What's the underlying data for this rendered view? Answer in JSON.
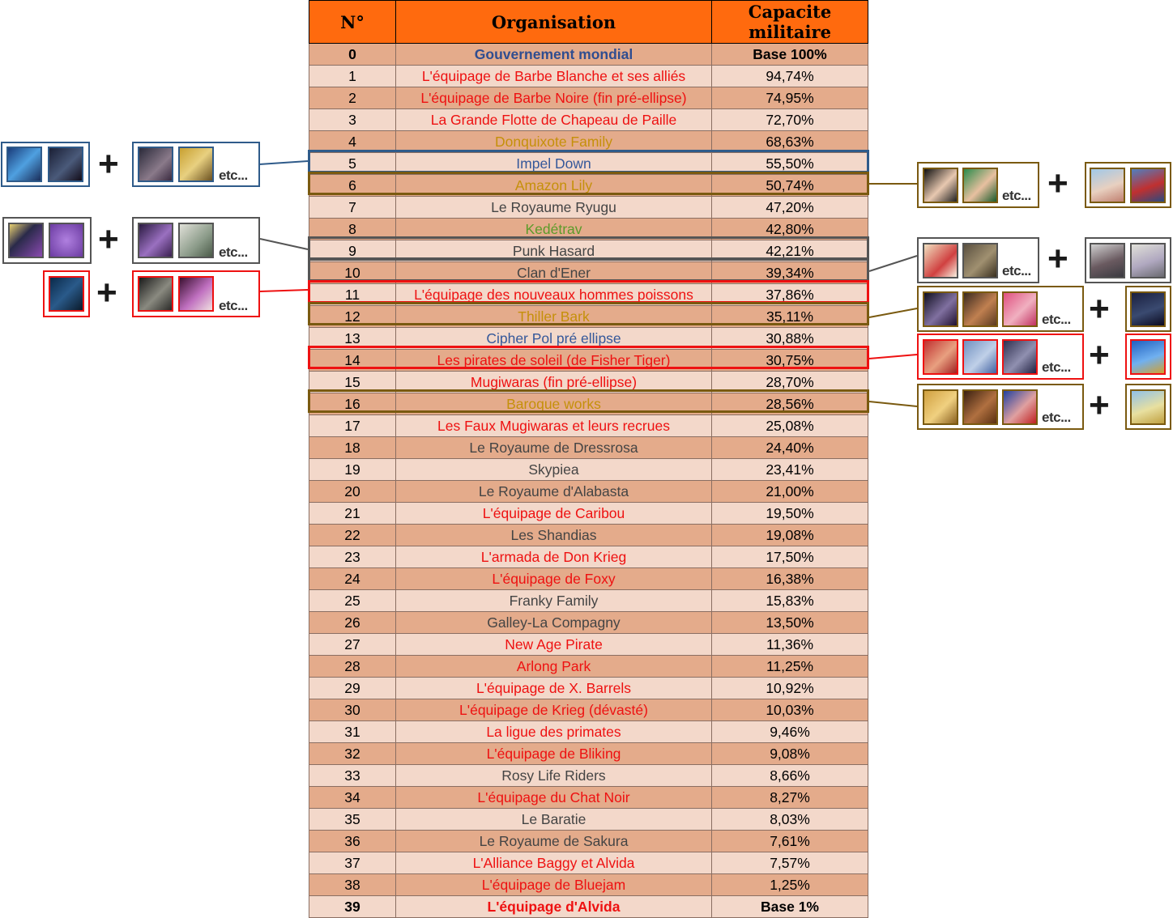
{
  "header": {
    "num": "N°",
    "org": "Organisation",
    "pct": "Capacite militaire"
  },
  "rows": [
    {
      "num": "0",
      "org": "Gouvernement mondial",
      "pct": "Base 100%",
      "color": "navy",
      "bold": true
    },
    {
      "num": "1",
      "org": "L'équipage de Barbe Blanche et ses alliés",
      "pct": "94,74%",
      "color": "red"
    },
    {
      "num": "2",
      "org": "L'équipage de Barbe Noire (fin pré-ellipse)",
      "pct": "74,95%",
      "color": "red"
    },
    {
      "num": "3",
      "org": "La Grande Flotte de Chapeau de Paille",
      "pct": "72,70%",
      "color": "red"
    },
    {
      "num": "4",
      "org": "Donquixote Family",
      "pct": "68,63%",
      "color": "gold"
    },
    {
      "num": "5",
      "org": "Impel Down",
      "pct": "55,50%",
      "color": "blue"
    },
    {
      "num": "6",
      "org": "Amazon Lily",
      "pct": "50,74%",
      "color": "gold"
    },
    {
      "num": "7",
      "org": "Le Royaume Ryugu",
      "pct": "47,20%",
      "color": "gray"
    },
    {
      "num": "8",
      "org": "Kedétrav",
      "pct": "42,80%",
      "color": "green"
    },
    {
      "num": "9",
      "org": "Punk Hasard",
      "pct": "42,21%",
      "color": "gray"
    },
    {
      "num": "10",
      "org": "Clan d'Ener",
      "pct": "39,34%",
      "color": "gray"
    },
    {
      "num": "11",
      "org": "L'équipage des nouveaux hommes poissons",
      "pct": "37,86%",
      "color": "red"
    },
    {
      "num": "12",
      "org": "Thiller Bark",
      "pct": "35,11%",
      "color": "gold"
    },
    {
      "num": "13",
      "org": "Cipher Pol pré ellipse",
      "pct": "30,88%",
      "color": "blue"
    },
    {
      "num": "14",
      "org": "Les pirates de soleil (de Fisher Tiger)",
      "pct": "30,75%",
      "color": "red"
    },
    {
      "num": "15",
      "org": "Mugiwaras (fin pré-ellipse)",
      "pct": "28,70%",
      "color": "red"
    },
    {
      "num": "16",
      "org": "Baroque works",
      "pct": "28,56%",
      "color": "gold"
    },
    {
      "num": "17",
      "org": "Les Faux Mugiwaras et leurs recrues",
      "pct": "25,08%",
      "color": "red"
    },
    {
      "num": "18",
      "org": "Le Royaume de Dressrosa",
      "pct": "24,40%",
      "color": "gray"
    },
    {
      "num": "19",
      "org": "Skypiea",
      "pct": "23,41%",
      "color": "gray"
    },
    {
      "num": "20",
      "org": "Le Royaume d'Alabasta",
      "pct": "21,00%",
      "color": "gray"
    },
    {
      "num": "21",
      "org": "L'équipage de Caribou",
      "pct": "19,50%",
      "color": "red"
    },
    {
      "num": "22",
      "org": "Les Shandias",
      "pct": "19,08%",
      "color": "gray"
    },
    {
      "num": "23",
      "org": "L'armada de Don Krieg",
      "pct": "17,50%",
      "color": "red"
    },
    {
      "num": "24",
      "org": "L'équipage de Foxy",
      "pct": "16,38%",
      "color": "red"
    },
    {
      "num": "25",
      "org": "Franky Family",
      "pct": "15,83%",
      "color": "gray"
    },
    {
      "num": "26",
      "org": "Galley-La Compagny",
      "pct": "13,50%",
      "color": "gray"
    },
    {
      "num": "27",
      "org": "New Age Pirate",
      "pct": "11,36%",
      "color": "red"
    },
    {
      "num": "28",
      "org": "Arlong Park",
      "pct": "11,25%",
      "color": "red"
    },
    {
      "num": "29",
      "org": "L'équipage de X. Barrels",
      "pct": "10,92%",
      "color": "red"
    },
    {
      "num": "30",
      "org": "L'équipage de Krieg (dévasté)",
      "pct": "10,03%",
      "color": "red"
    },
    {
      "num": "31",
      "org": "La ligue des primates",
      "pct": "9,46%",
      "color": "red"
    },
    {
      "num": "32",
      "org": "L'équipage de Bliking",
      "pct": "9,08%",
      "color": "red"
    },
    {
      "num": "33",
      "org": "Rosy Life Riders",
      "pct": "8,66%",
      "color": "gray"
    },
    {
      "num": "34",
      "org": "L'équipage du Chat Noir",
      "pct": "8,27%",
      "color": "red"
    },
    {
      "num": "35",
      "org": "Le Baratie",
      "pct": "8,03%",
      "color": "gray"
    },
    {
      "num": "36",
      "org": "Le Royaume de Sakura",
      "pct": "7,61%",
      "color": "gray"
    },
    {
      "num": "37",
      "org": "L'Alliance Baggy et Alvida",
      "pct": "7,57%",
      "color": "red"
    },
    {
      "num": "38",
      "org": "L'équipage de Bluejam",
      "pct": "1,25%",
      "color": "red"
    },
    {
      "num": "39",
      "org": "L'équipage d'Alvida",
      "pct": "Base 1%",
      "color": "red",
      "bold": true
    }
  ],
  "annotations": {
    "etc_label": "etc...",
    "plus_label": "+",
    "highlighted_rows": [
      {
        "row": "5",
        "color": "#2f5b8a"
      },
      {
        "row": "6",
        "color": "#7a5a10"
      },
      {
        "row": "9",
        "color": "#555555"
      },
      {
        "row": "10",
        "color": "#555555"
      },
      {
        "row": "11",
        "color": "#ee1111"
      },
      {
        "row": "12",
        "color": "#7a5a10"
      },
      {
        "row": "14",
        "color": "#ee1111"
      },
      {
        "row": "16",
        "color": "#7a5a10"
      }
    ]
  },
  "colors": {
    "header_bg": "#ff6a0e",
    "row_even_bg": "#e4ab8b",
    "row_odd_bg": "#f3d8ca"
  }
}
